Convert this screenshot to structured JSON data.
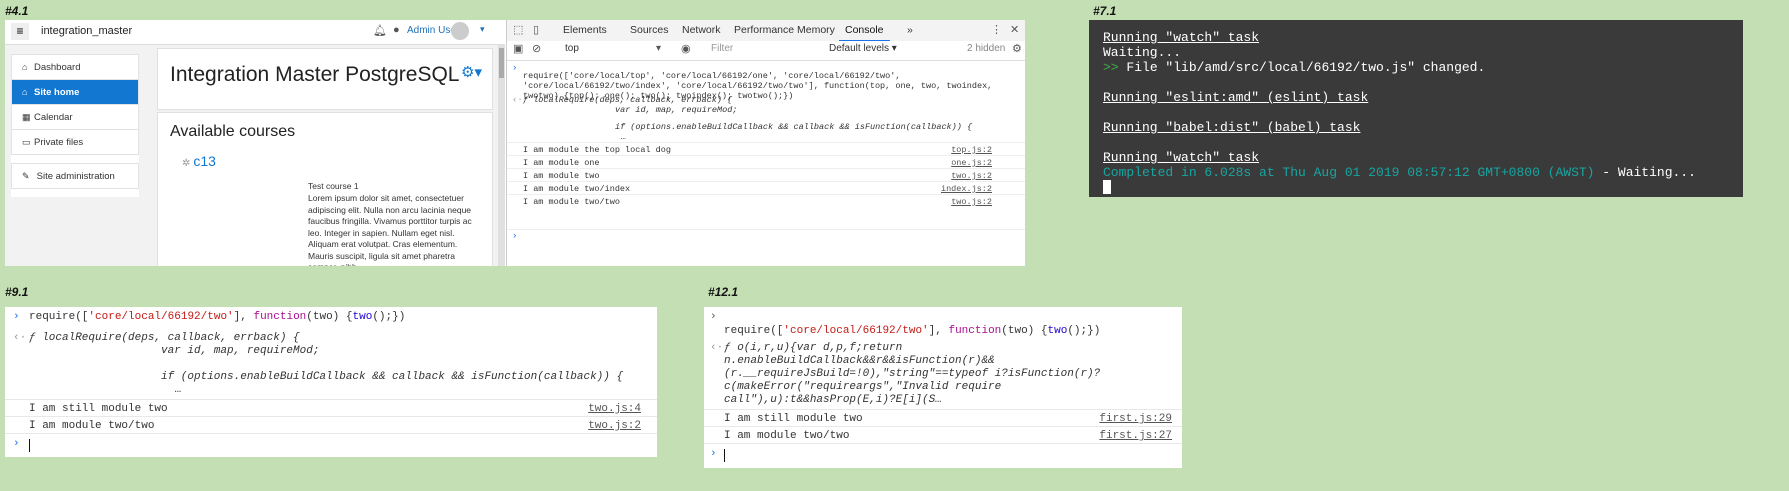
{
  "labels": {
    "p41": "#4.1",
    "p71": "#7.1",
    "p91": "#9.1",
    "p121": "#12.1"
  },
  "moodle": {
    "site_name": "integration_master",
    "user_name": "Admin User",
    "sidebar": [
      {
        "icon": "dashboard-icon",
        "glyph": "⌂",
        "label": "Dashboard"
      },
      {
        "icon": "home-icon",
        "glyph": "⌂",
        "label": "Site home",
        "active": true
      },
      {
        "icon": "calendar-icon",
        "glyph": "▦",
        "label": "Calendar"
      },
      {
        "icon": "file-icon",
        "glyph": "▭",
        "label": "Private files"
      }
    ],
    "sidebar_admin": {
      "icon": "wrench-icon",
      "glyph": "✎",
      "label": "Site administration"
    },
    "page_title": "Integration Master PostgreSQL",
    "available_courses": "Available courses",
    "course_name": "c13",
    "course_title": "Test course 1",
    "course_summary": "Lorem ipsum dolor sit amet, consectetuer adipiscing elit. Nulla non arcu lacinia neque faucibus fringilla. Vivamus porttitor turpis ac leo. Integer in sapien. Nullam eget nisl. Aliquam erat volutpat. Cras elementum. Mauris suscipit, ligula sit amet pharetra semper, nibh"
  },
  "devtools": {
    "tabs": [
      "Elements",
      "Sources",
      "Network",
      "Performance",
      "Memory",
      "Console"
    ],
    "active_tab": "Console",
    "more": "»",
    "context": "top",
    "filter_placeholder": "Filter",
    "levels": "Default levels ▾",
    "hidden": "2 hidden",
    "input_line1a": "require(['core/local/top', 'core/local/66192/one', 'core/local/66192/two',",
    "input_line2a": "'core/local/66192/two/index', 'core/local/66192/two/two'], function(top, one, two, twoindex,",
    "input_line3a": "twotwo) {top(); one(); two(); twoindex(); twotwo();})",
    "return_line1": "ƒ localRequire(deps, callback, errback) {",
    "return_line2": "var id, map, requireMod;",
    "return_line3": "if (options.enableBuildCallback && callback && isFunction(callback)) {",
    "return_line4": "…",
    "logs": [
      {
        "text": "I am module the top local dog",
        "src": "top.js:2"
      },
      {
        "text": "I am module one",
        "src": "one.js:2"
      },
      {
        "text": "I am module two",
        "src": "two.js:2"
      },
      {
        "text": "I am module two/index",
        "src": "index.js:2"
      },
      {
        "text": "I am module two/two",
        "src": "two.js:2"
      }
    ]
  },
  "terminal": {
    "l1": "Running \"watch\" task",
    "l2": "Waiting...",
    "l3a": ">>",
    "l3b": " File \"lib/amd/src/local/66192/two.js\" changed.",
    "l4": "Running \"eslint:amd\" (eslint) task",
    "l5": "Running \"babel:dist\" (babel) task",
    "l6": "Running \"watch\" task",
    "l7a": "Completed in 6.028s at Thu Aug 01 2019 08:57:12 GMT+0800 (AWST)",
    "l7b": " - Waiting..."
  },
  "console91": {
    "input_a": "require([",
    "input_str": "'core/local/66192/two'",
    "input_b": "], ",
    "input_kw": "function",
    "input_c": "(two) {",
    "input_d": "two",
    "input_e": "();})",
    "ret1": "ƒ localRequire(deps, callback, errback) {",
    "ret2": "var id, map, requireMod;",
    "ret3": "if (options.enableBuildCallback && callback && isFunction(callback)) {",
    "ret4": "…",
    "logs": [
      {
        "text": "I am still module two",
        "src": "two.js:4"
      },
      {
        "text": "I am module two/two",
        "src": "two.js:2"
      }
    ]
  },
  "console121": {
    "input_a": "require([",
    "input_str": "'core/local/66192/two'",
    "input_b": "], ",
    "input_kw": "function",
    "input_c": "(two) {",
    "input_d": "two",
    "input_e": "();})",
    "ret1": "ƒ o(i,r,u){var d,p,f;return",
    "ret2": "n.enableBuildCallback&&r&&isFunction(r)&&",
    "ret3": "(r.__requireJsBuild=!0),\"string\"==typeof i?isFunction(r)?",
    "ret4": "c(makeError(\"requireargs\",\"Invalid require",
    "ret5": "call\"),u):t&&hasProp(E,i)?E[i](S…",
    "logs": [
      {
        "text": "I am still module two",
        "src": "first.js:29"
      },
      {
        "text": "I am module two/two",
        "src": "first.js:27"
      }
    ]
  }
}
